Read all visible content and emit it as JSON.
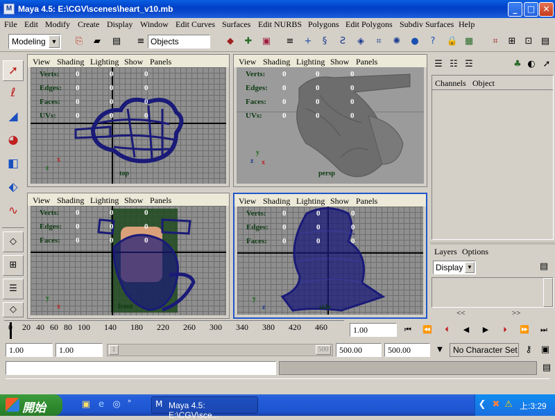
{
  "window": {
    "title": "Maya 4.5: E:\\CGV\\scenes\\heart_v10.mb",
    "minimize": "_",
    "maximize": "□",
    "close": "✕"
  },
  "menu": [
    "File",
    "Edit",
    "Modify",
    "Create",
    "Display",
    "Window",
    "Edit Curves",
    "Surfaces",
    "Edit NURBS",
    "Polygons",
    "Edit Polygons",
    "Subdiv Surfaces",
    "Help"
  ],
  "status_line": {
    "menu_set": "Modeling",
    "selection_mask": "Objects"
  },
  "viewport_menu": [
    "View",
    "Shading",
    "Lighting",
    "Show",
    "Panels"
  ],
  "hud_labels": [
    "Verts:",
    "Edges:",
    "Faces:",
    "UVs:"
  ],
  "viewports": [
    {
      "name": "top",
      "label": "top",
      "values": [
        "0",
        "0",
        "0",
        "0",
        "0",
        "0",
        "0",
        "0",
        "0",
        "0",
        "0",
        "0"
      ],
      "rows": 4
    },
    {
      "name": "persp",
      "label": "persp",
      "values": [
        "0",
        "0",
        "0",
        "0",
        "0",
        "0",
        "0",
        "0",
        "0",
        "0",
        "0",
        "0"
      ],
      "rows": 4
    },
    {
      "name": "front",
      "label": "front",
      "values": [
        "0",
        "0",
        "0",
        "0",
        "0",
        "0",
        "0",
        "0",
        "0"
      ],
      "rows": 3
    },
    {
      "name": "side",
      "label": "side",
      "values": [
        "0",
        "0",
        "0",
        "0",
        "0",
        "0",
        "0",
        "0",
        "0"
      ],
      "rows": 3
    }
  ],
  "axis": {
    "x": "x",
    "y": "y",
    "z": "z"
  },
  "channel_box": {
    "tab_channels": "Channels",
    "tab_object": "Object"
  },
  "layers": {
    "title_layers": "Layers",
    "title_options": "Options",
    "display_select": "Display",
    "nav_left": "<<",
    "nav_right": ">>"
  },
  "time_slider": {
    "ticks": [
      "0",
      "20",
      "40",
      "60",
      "80",
      "100",
      "140",
      "180",
      "220",
      "260",
      "300",
      "340",
      "380",
      "420",
      "460"
    ],
    "current_frame": "1.00"
  },
  "range_slider": {
    "start": "1.00",
    "playback_start": "1.00",
    "range_inner_start": "1",
    "range_inner_end": "500",
    "playback_end": "500.00",
    "end": "500.00",
    "character_set": "No Character Set"
  },
  "taskbar": {
    "start": "開始",
    "task": "Maya 4.5: E:\\CGV\\sce...",
    "clock": "上:3:29"
  },
  "colors": {
    "wire": "#1a1a78",
    "hud_text": "#0d3a12",
    "active_border": "#1f56c9",
    "title_blue": "#0845c9"
  }
}
